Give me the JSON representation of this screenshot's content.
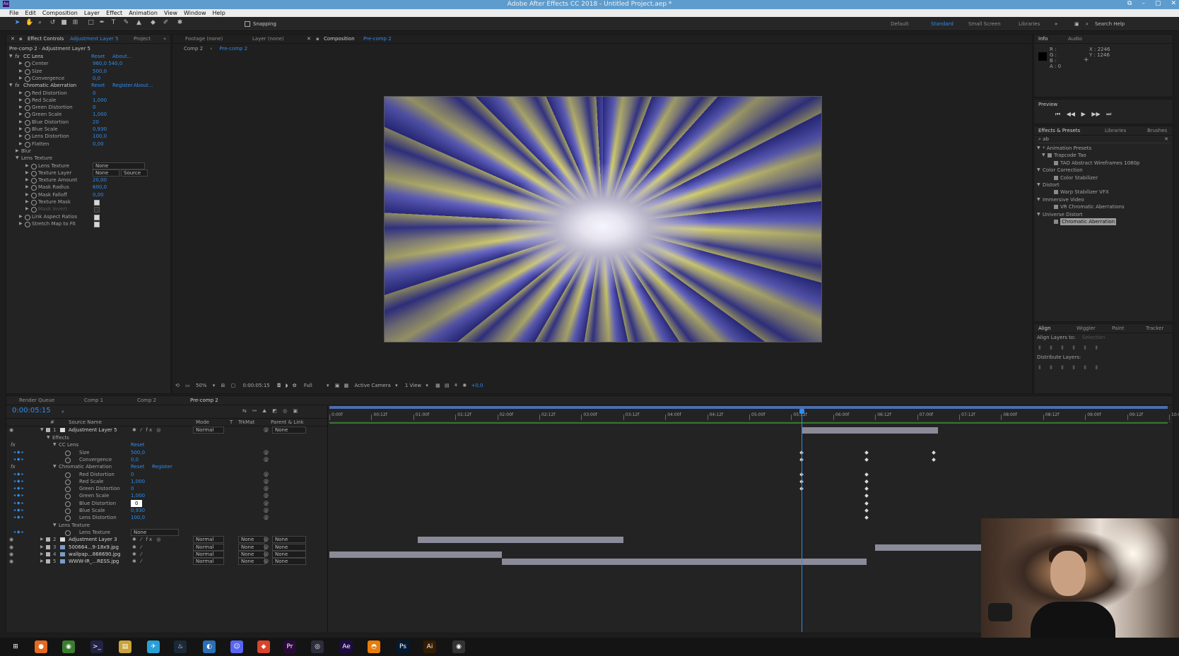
{
  "app": {
    "title": "Adobe After Effects CC 2018 - Untitled Project.aep *",
    "icon_label": "Ae",
    "window_buttons": [
      "⧉",
      "–",
      "▢",
      "✕"
    ]
  },
  "menu": [
    "File",
    "Edit",
    "Composition",
    "Layer",
    "Effect",
    "Animation",
    "View",
    "Window",
    "Help"
  ],
  "toolbar": {
    "snapping_label": "Snapping",
    "workspaces": [
      "Default",
      "Standard",
      "Small Screen",
      "Libraries"
    ],
    "active_workspace": "Standard",
    "search_help": "Search Help"
  },
  "effect_controls": {
    "tabs": [
      "Effect Controls",
      "Adjustment Layer 5",
      "Project"
    ],
    "header": "Pre-comp 2 · Adjustment Layer 5",
    "rows": [
      {
        "label": "CC Lens",
        "type": "fx",
        "links": [
          "Reset",
          "About..."
        ]
      },
      {
        "label": "Center",
        "value": "960,0 540,0",
        "indent": 2
      },
      {
        "label": "Size",
        "value": "500,0",
        "indent": 2
      },
      {
        "label": "Convergence",
        "value": "0,0",
        "indent": 2
      },
      {
        "label": "Chromatic Aberration",
        "type": "fx",
        "links": [
          "Reset",
          "Register",
          "About..."
        ]
      },
      {
        "label": "Red Distortion",
        "value": "0",
        "indent": 2
      },
      {
        "label": "Red Scale",
        "value": "1,000",
        "indent": 2
      },
      {
        "label": "Green Distortion",
        "value": "0",
        "indent": 2
      },
      {
        "label": "Green Scale",
        "value": "1,000",
        "indent": 2
      },
      {
        "label": "Blue Distortion",
        "value": "20",
        "indent": 2
      },
      {
        "label": "Blue Scale",
        "value": "0,930",
        "indent": 2
      },
      {
        "label": "Lens Distortion",
        "value": "100,0",
        "indent": 2
      },
      {
        "label": "Flatten",
        "value": "0,00",
        "indent": 2
      },
      {
        "label": "Blur",
        "indent": 1
      },
      {
        "label": "Lens Texture",
        "indent": 1
      },
      {
        "label": "Lens Texture",
        "dropdown": "None",
        "indent": 3
      },
      {
        "label": "Texture Layer",
        "dropdown": "None",
        "dropdown2": "Source",
        "indent": 3
      },
      {
        "label": "Texture Amount",
        "value": "20,00",
        "indent": 3
      },
      {
        "label": "Mask Radius",
        "value": "600,0",
        "indent": 3
      },
      {
        "label": "Mask Falloff",
        "value": "0,00",
        "indent": 3
      },
      {
        "label": "Texture Mask",
        "checkbox": true,
        "indent": 3
      },
      {
        "label": "Mask Invert",
        "checkbox": false,
        "indent": 3,
        "dim": true
      },
      {
        "label": "Link Aspect Ratios",
        "checkbox": true,
        "indent": 2
      },
      {
        "label": "Stretch Map to Fit",
        "checkbox": true,
        "indent": 2
      }
    ]
  },
  "composition": {
    "tabs": [
      "Footage (none)",
      "Layer (none)",
      "Composition",
      "Pre-comp 2"
    ],
    "breadcrumbs": [
      "Comp 2",
      "Pre-comp 2"
    ],
    "footer": {
      "zoom": "50%",
      "timecode": "0:00:05:15",
      "resolution": "Full",
      "camera": "Active Camera",
      "views": "1 View",
      "exposure": "+0,0"
    }
  },
  "info": {
    "tabs": [
      "Info",
      "Audio"
    ],
    "channels": [
      "R :",
      "G :",
      "B :",
      "A : 0"
    ],
    "coords": [
      "X : 2246",
      "Y : 1246"
    ]
  },
  "preview": {
    "title": "Preview",
    "buttons": [
      "⏮",
      "◀◀",
      "▶",
      "▶▶",
      "⏭"
    ]
  },
  "effects_presets": {
    "tabs": [
      "Effects & Presets",
      "Libraries",
      "Brushes"
    ],
    "search": "ab",
    "tree": [
      {
        "label": "* Animation Presets",
        "level": 0
      },
      {
        "label": "Trapcode Tao",
        "level": 1
      },
      {
        "label": "TAO Abstract Wireframes 1080p",
        "level": 2
      },
      {
        "label": "Color Correction",
        "level": 0
      },
      {
        "label": "Color Stabilizer",
        "level": 2
      },
      {
        "label": "Distort",
        "level": 0
      },
      {
        "label": "Warp Stabilizer VFX",
        "level": 2
      },
      {
        "label": "Immersive Video",
        "level": 0
      },
      {
        "label": "VR Chromatic Aberrations",
        "level": 2
      },
      {
        "label": "Universe Distort",
        "level": 0
      },
      {
        "label": "Chromatic Aberration",
        "level": 2,
        "selected": true
      }
    ]
  },
  "align": {
    "tabs": [
      "Align",
      "Wiggler",
      "Paint",
      "Tracker"
    ],
    "align_to_label": "Align Layers to:",
    "align_to_value": "Selection",
    "distribute_label": "Distribute Layers:"
  },
  "timeline": {
    "tabs": [
      "Render Queue",
      "Comp 1",
      "Comp 2",
      "Pre-comp 2"
    ],
    "active_tab": "Pre-comp 2",
    "timecode": "0:00:05:15",
    "columns": [
      "#",
      "Source Name",
      "Mode",
      "T",
      "TrkMat",
      "Parent & Link"
    ],
    "ruler": [
      "0:00f",
      "00:12f",
      "01:00f",
      "01:12f",
      "02:00f",
      "02:12f",
      "03:00f",
      "03:12f",
      "04:00f",
      "04:12f",
      "05:00f",
      "05:12f",
      "06:00f",
      "06:12f",
      "07:00f",
      "07:12f",
      "08:00f",
      "08:12f",
      "09:00f",
      "09:12f",
      "10:0"
    ],
    "playhead_seconds": 5.625,
    "duration_seconds": 10,
    "layers": [
      {
        "num": "1",
        "name": "Adjustment Layer 5",
        "mode": "Normal",
        "trkmat": "",
        "parent": "None",
        "in": 5.625,
        "out": 7.25
      },
      {
        "num": "2",
        "name": "Adjustment Layer 3",
        "mode": "Normal",
        "trkmat": "None",
        "parent": "None",
        "in": 1.05,
        "out": 3.5
      },
      {
        "num": "3",
        "name": "500664...9-18x9.jpg",
        "mode": "Normal",
        "trkmat": "None",
        "parent": "None",
        "in": 6.5,
        "out": 10
      },
      {
        "num": "4",
        "name": "wallpap...868690.jpg",
        "mode": "Normal",
        "trkmat": "None",
        "parent": "None",
        "in": 0,
        "out": 2.05
      },
      {
        "num": "5",
        "name": "WWW-IR_...RESS.jpg",
        "mode": "Normal",
        "trkmat": "None",
        "parent": "None",
        "in": 2.05,
        "out": 6.4
      }
    ],
    "props": [
      {
        "label": "Effects",
        "level": 1
      },
      {
        "label": "CC Lens",
        "level": 2,
        "links": [
          "Reset"
        ]
      },
      {
        "label": "Size",
        "value": "500,0",
        "level": 3,
        "keys": [
          5.625,
          6.4,
          7.2
        ]
      },
      {
        "label": "Convergence",
        "value": "0,0",
        "level": 3,
        "keys": [
          5.625,
          6.4,
          7.2
        ]
      },
      {
        "label": "Chromatic Aberration",
        "level": 2,
        "links": [
          "Reset",
          "Register"
        ]
      },
      {
        "label": "Red Distortion",
        "value": "0",
        "level": 3,
        "keys": [
          5.625,
          6.4
        ]
      },
      {
        "label": "Red Scale",
        "value": "1,000",
        "level": 3,
        "keys": [
          5.625,
          6.4
        ]
      },
      {
        "label": "Green Distortion",
        "value": "0",
        "level": 3,
        "keys": [
          5.625,
          6.4
        ]
      },
      {
        "label": "Green Scale",
        "value": "1,000",
        "level": 3,
        "keys": [
          6.4
        ]
      },
      {
        "label": "Blue Distortion",
        "value": "0",
        "level": 3,
        "keys": [
          6.4
        ],
        "editing": true
      },
      {
        "label": "Blue Scale",
        "value": "0,930",
        "level": 3,
        "keys": [
          6.4
        ]
      },
      {
        "label": "Lens Distortion",
        "value": "100,0",
        "level": 3,
        "keys": [
          6.4
        ]
      },
      {
        "label": "Lens Texture",
        "level": 2
      },
      {
        "label": "Lens Texture",
        "dropdown": "None",
        "level": 3
      }
    ]
  },
  "taskbar": {
    "apps": [
      {
        "name": "windows-start",
        "glyph": "⊞",
        "color": "#141414"
      },
      {
        "name": "firefox",
        "glyph": "●",
        "color": "#e56a1f"
      },
      {
        "name": "chrome",
        "glyph": "◉",
        "color": "#3a7d2f"
      },
      {
        "name": "terminal",
        "glyph": ">_",
        "color": "#222244"
      },
      {
        "name": "explorer",
        "glyph": "▤",
        "color": "#c9a43b"
      },
      {
        "name": "telegram",
        "glyph": "✈",
        "color": "#2a9fd6"
      },
      {
        "name": "steam",
        "glyph": "♨",
        "color": "#1b2838"
      },
      {
        "name": "browser",
        "glyph": "◐",
        "color": "#2a6fb8"
      },
      {
        "name": "discord",
        "glyph": "☺",
        "color": "#5865f2"
      },
      {
        "name": "app-red",
        "glyph": "◆",
        "color": "#d8452b"
      },
      {
        "name": "premiere",
        "glyph": "Pr",
        "color": "#2a0a3a"
      },
      {
        "name": "obs",
        "glyph": "◎",
        "color": "#2c2c3c"
      },
      {
        "name": "after-effects",
        "glyph": "Ae",
        "color": "#1f0a44"
      },
      {
        "name": "blender",
        "glyph": "◓",
        "color": "#e87d0d"
      },
      {
        "name": "photoshop",
        "glyph": "Ps",
        "color": "#031a33"
      },
      {
        "name": "illustrator",
        "glyph": "Ai",
        "color": "#331c00"
      },
      {
        "name": "obs-studio",
        "glyph": "◉",
        "color": "#333"
      }
    ]
  }
}
